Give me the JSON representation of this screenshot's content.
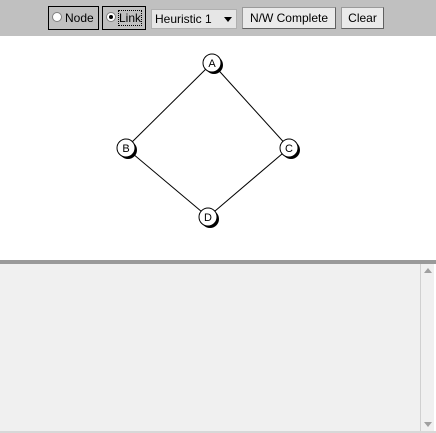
{
  "toolbar": {
    "mode_options": [
      {
        "label": "Node",
        "checked": false
      },
      {
        "label": "Link",
        "checked": true
      }
    ],
    "heuristic": {
      "selected": "Heuristic 1"
    },
    "nw_complete_label": "N/W Complete",
    "clear_label": "Clear"
  },
  "graph": {
    "nodes": [
      {
        "id": "A",
        "label": "A"
      },
      {
        "id": "B",
        "label": "B"
      },
      {
        "id": "C",
        "label": "C"
      },
      {
        "id": "D",
        "label": "D"
      }
    ],
    "edges": [
      [
        "A",
        "B"
      ],
      [
        "A",
        "C"
      ],
      [
        "B",
        "D"
      ],
      [
        "C",
        "D"
      ]
    ]
  },
  "output": {
    "text": ""
  }
}
